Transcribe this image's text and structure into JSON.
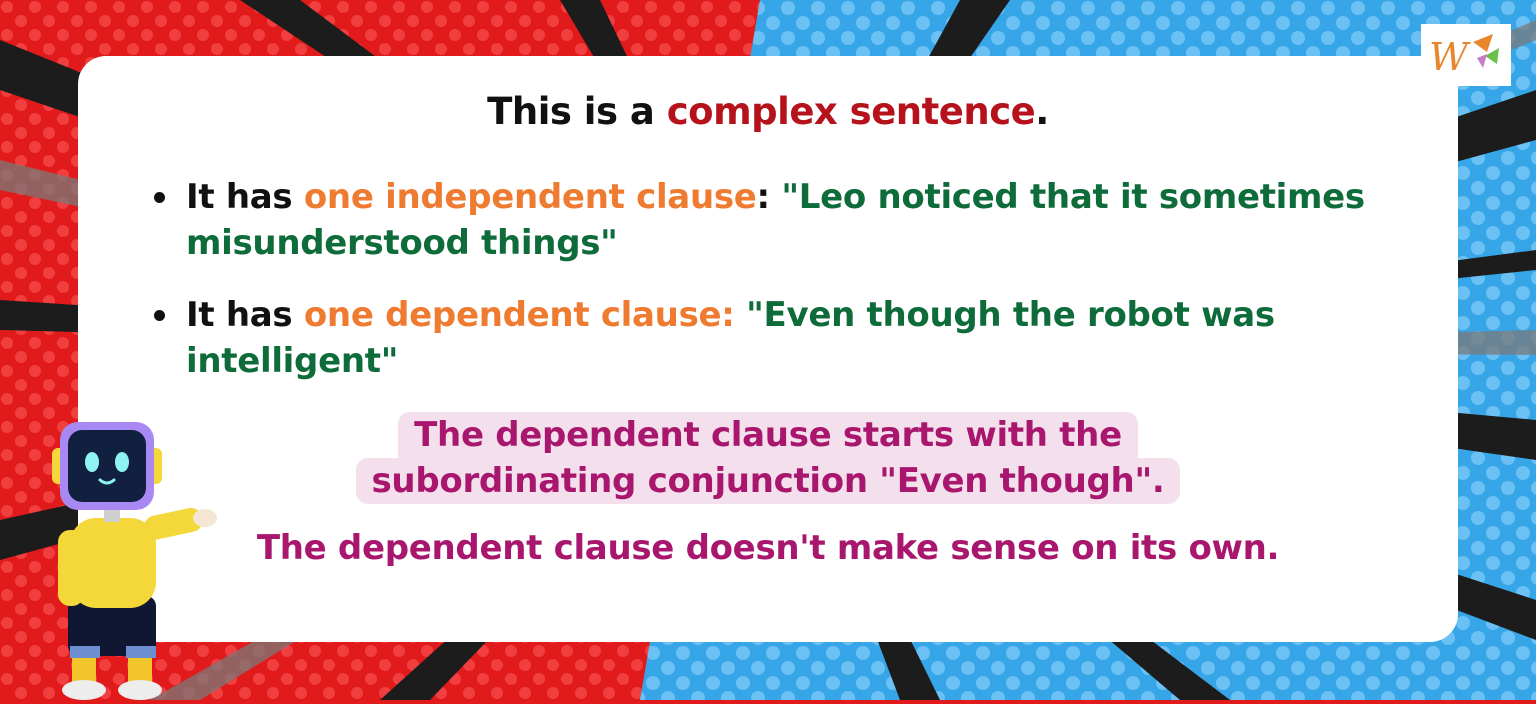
{
  "title": {
    "part1": "This is a ",
    "emphasis": "complex sentence",
    "part2": "."
  },
  "bullets": [
    {
      "lead": "It has ",
      "label": "one independent clause",
      "sep": ": ",
      "quote": "\"Leo noticed that it sometimes misunderstood things\""
    },
    {
      "lead": "It has ",
      "label": "one dependent clause: ",
      "sep": "",
      "quote": "\"Even though the robot was intelligent\""
    }
  ],
  "highlight": {
    "line1": "The dependent clause starts with the",
    "line2": "subordinating conjunction \"Even though\"."
  },
  "note": "The dependent clause doesn't make sense on its own.",
  "logo": {
    "icon": "w-logo-icon"
  },
  "colors": {
    "title_accent": "#b5121b",
    "label": "#ee7b30",
    "quote": "#0e6b3a",
    "highlight_text": "#a8166e",
    "highlight_bg": "#f3e0ec",
    "bg_left": "#e11b1b",
    "bg_right": "#3aa7e6"
  }
}
